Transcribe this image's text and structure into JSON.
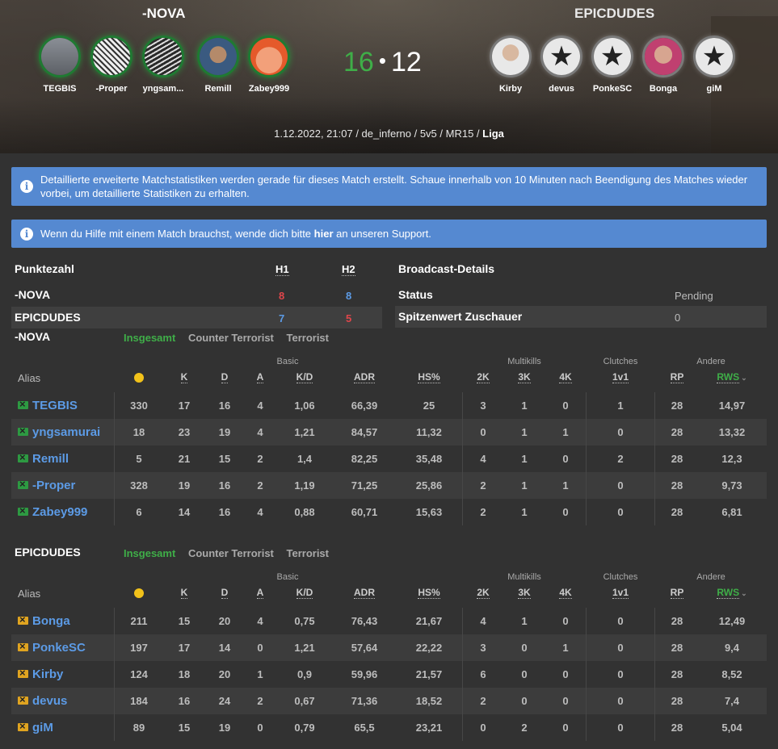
{
  "header": {
    "team_left": "-NOVA",
    "team_right": "EPICDUDES",
    "players_left": [
      {
        "name": "TEGBIS",
        "avatar": "avatar-tegbis"
      },
      {
        "name": "-Proper",
        "avatar": "avatar-proper"
      },
      {
        "name": "yngsam...",
        "avatar": "avatar-yngsamurai"
      },
      {
        "name": "Remill",
        "avatar": "avatar-remill"
      },
      {
        "name": "Zabey999",
        "avatar": "avatar-zabey"
      }
    ],
    "players_right": [
      {
        "name": "Kirby",
        "avatar": "avatar-kirby"
      },
      {
        "name": "devus",
        "avatar": "star-icon"
      },
      {
        "name": "PonkeSC",
        "avatar": "star-icon"
      },
      {
        "name": "Bonga",
        "avatar": "avatar-bonga"
      },
      {
        "name": "giM",
        "avatar": "star-icon"
      }
    ],
    "score_left": "16",
    "score_sep": "•",
    "score_right": "12",
    "match_info": "1.12.2022, 21:07 / de_inferno / 5v5 / MR15 / ",
    "match_type": "Liga"
  },
  "alerts": {
    "stats_notice": "Detaillierte erweiterte Matchstatistiken werden gerade für dieses Match erstellt. Schaue innerhalb von 10 Minuten nach Beendigung des Matches wieder vorbei, um detaillierte Statistiken zu erhalten.",
    "support_before": "Wenn du Hilfe mit einem Match brauchst, wende dich bitte ",
    "support_link": "hier",
    "support_after": " an unseren Support."
  },
  "score_table": {
    "title": "Punktezahl",
    "h1": "H1",
    "h2": "H2",
    "rows": [
      {
        "team": "-NOVA",
        "h1": "8",
        "h2": "8"
      },
      {
        "team": "EPICDUDES",
        "h1": "7",
        "h2": "5"
      }
    ]
  },
  "broadcast": {
    "title": "Broadcast-Details",
    "status_label": "Status",
    "status_value": "Pending",
    "peak_label": "Spitzenwert Zuschauer",
    "peak_value": "0"
  },
  "stats_labels": {
    "tab_overall": "Insgesamt",
    "tab_ct": "Counter Terrorist",
    "tab_t": "Terrorist",
    "grp_basic": "Basic",
    "grp_multikills": "Multikills",
    "grp_clutches": "Clutches",
    "grp_other": "Andere",
    "alias": "Alias",
    "cols": [
      "K",
      "D",
      "A",
      "K/D",
      "ADR",
      "HS%",
      "2K",
      "3K",
      "4K",
      "1v1",
      "RP",
      "RWS"
    ],
    "sort_icon": "chevron-down-icon",
    "score_col_icon": "smiley-icon"
  },
  "team1": {
    "name": "-NOVA",
    "flag_color": "#2d9a42",
    "players": [
      {
        "name": "TEGBIS",
        "s": "330",
        "k": "17",
        "d": "16",
        "a": "4",
        "kd": "1,06",
        "adr": "66,39",
        "hs": "25",
        "k2": "3",
        "k3": "1",
        "k4": "0",
        "v1": "1",
        "rp": "28",
        "rws": "14,97"
      },
      {
        "name": "yngsamurai",
        "s": "18",
        "k": "23",
        "d": "19",
        "a": "4",
        "kd": "1,21",
        "adr": "84,57",
        "hs": "11,32",
        "k2": "0",
        "k3": "1",
        "k4": "1",
        "v1": "0",
        "rp": "28",
        "rws": "13,32"
      },
      {
        "name": "Remill",
        "s": "5",
        "k": "21",
        "d": "15",
        "a": "2",
        "kd": "1,4",
        "adr": "82,25",
        "hs": "35,48",
        "k2": "4",
        "k3": "1",
        "k4": "0",
        "v1": "2",
        "rp": "28",
        "rws": "12,3"
      },
      {
        "name": "-Proper",
        "s": "328",
        "k": "19",
        "d": "16",
        "a": "2",
        "kd": "1,19",
        "adr": "71,25",
        "hs": "25,86",
        "k2": "2",
        "k3": "1",
        "k4": "1",
        "v1": "0",
        "rp": "28",
        "rws": "9,73"
      },
      {
        "name": "Zabey999",
        "s": "6",
        "k": "14",
        "d": "16",
        "a": "4",
        "kd": "0,88",
        "adr": "60,71",
        "hs": "15,63",
        "k2": "2",
        "k3": "1",
        "k4": "0",
        "v1": "0",
        "rp": "28",
        "rws": "6,81"
      }
    ]
  },
  "team2": {
    "name": "EPICDUDES",
    "flag_color": "#e0a420",
    "players": [
      {
        "name": "Bonga",
        "s": "211",
        "k": "15",
        "d": "20",
        "a": "4",
        "kd": "0,75",
        "adr": "76,43",
        "hs": "21,67",
        "k2": "4",
        "k3": "1",
        "k4": "0",
        "v1": "0",
        "rp": "28",
        "rws": "12,49"
      },
      {
        "name": "PonkeSC",
        "s": "197",
        "k": "17",
        "d": "14",
        "a": "0",
        "kd": "1,21",
        "adr": "57,64",
        "hs": "22,22",
        "k2": "3",
        "k3": "0",
        "k4": "1",
        "v1": "0",
        "rp": "28",
        "rws": "9,4"
      },
      {
        "name": "Kirby",
        "s": "124",
        "k": "18",
        "d": "20",
        "a": "1",
        "kd": "0,9",
        "adr": "59,96",
        "hs": "21,57",
        "k2": "6",
        "k3": "0",
        "k4": "0",
        "v1": "0",
        "rp": "28",
        "rws": "8,52"
      },
      {
        "name": "devus",
        "s": "184",
        "k": "16",
        "d": "24",
        "a": "2",
        "kd": "0,67",
        "adr": "71,36",
        "hs": "18,52",
        "k2": "2",
        "k3": "0",
        "k4": "0",
        "v1": "0",
        "rp": "28",
        "rws": "7,4"
      },
      {
        "name": "giM",
        "s": "89",
        "k": "15",
        "d": "19",
        "a": "0",
        "kd": "0,79",
        "adr": "65,5",
        "hs": "23,21",
        "k2": "0",
        "k3": "2",
        "k4": "0",
        "v1": "0",
        "rp": "28",
        "rws": "5,04"
      }
    ]
  }
}
